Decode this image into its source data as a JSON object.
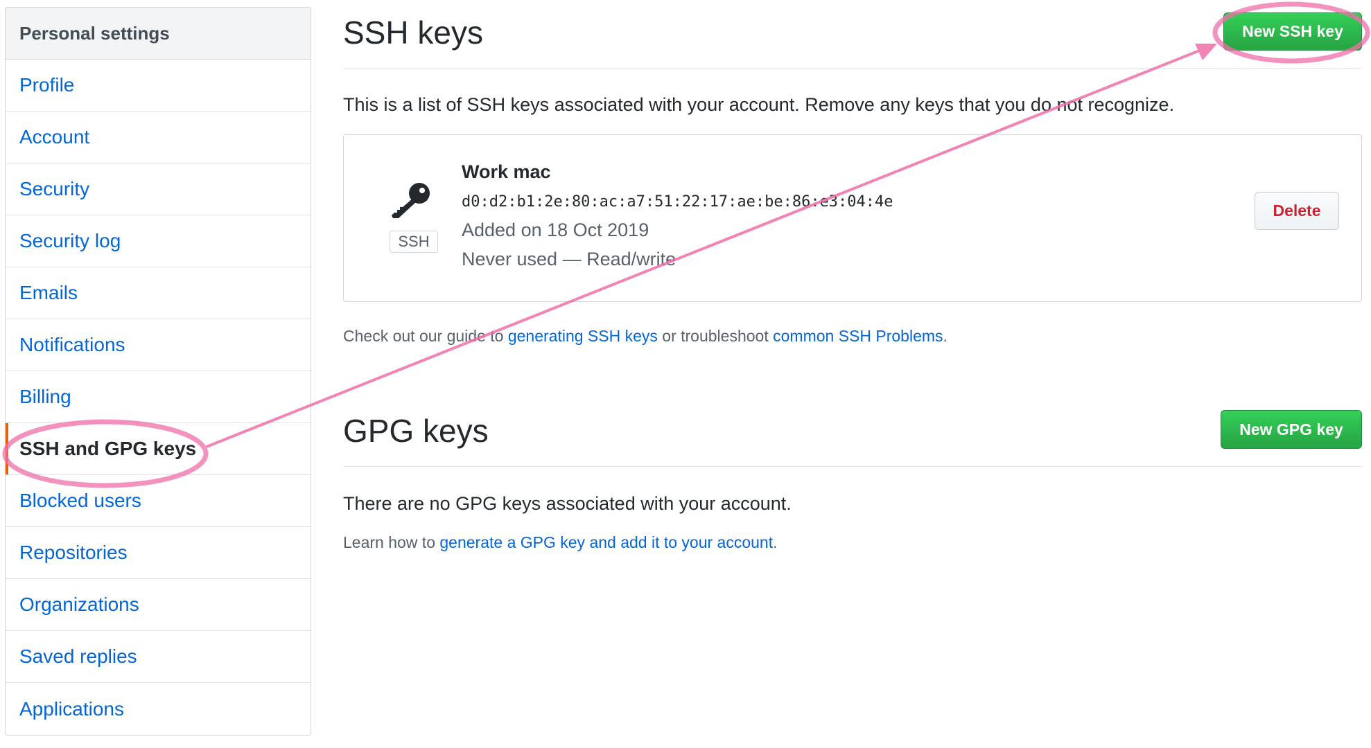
{
  "sidebar": {
    "header": "Personal settings",
    "items": [
      {
        "label": "Profile"
      },
      {
        "label": "Account"
      },
      {
        "label": "Security"
      },
      {
        "label": "Security log"
      },
      {
        "label": "Emails"
      },
      {
        "label": "Notifications"
      },
      {
        "label": "Billing"
      },
      {
        "label": "SSH and GPG keys",
        "selected": true
      },
      {
        "label": "Blocked users"
      },
      {
        "label": "Repositories"
      },
      {
        "label": "Organizations"
      },
      {
        "label": "Saved replies"
      },
      {
        "label": "Applications"
      }
    ]
  },
  "ssh": {
    "title": "SSH keys",
    "new_button": "New SSH key",
    "intro": "This is a list of SSH keys associated with your account. Remove any keys that you do not recognize.",
    "key": {
      "icon": "key-icon",
      "badge": "SSH",
      "title": "Work mac",
      "fingerprint": "d0:d2:b1:2e:80:ac:a7:51:22:17:ae:be:86:e3:04:4e",
      "added": "Added on 18 Oct 2019",
      "usage": "Never used — Read/write",
      "delete_button": "Delete"
    },
    "guide": {
      "prefix": "Check out our guide to ",
      "link1": "generating SSH keys",
      "middle": " or troubleshoot ",
      "link2": "common SSH Problems",
      "suffix": "."
    }
  },
  "gpg": {
    "title": "GPG keys",
    "new_button": "New GPG key",
    "empty_text": "There are no GPG keys associated with your account.",
    "learn": {
      "prefix": "Learn how to ",
      "link": "generate a GPG key and add it to your account",
      "suffix": "."
    }
  },
  "colors": {
    "link": "#0366d6",
    "green_button": "#28a745",
    "danger": "#cb2431",
    "selected_marker": "#e36209",
    "annotation": "#f06ea9"
  }
}
